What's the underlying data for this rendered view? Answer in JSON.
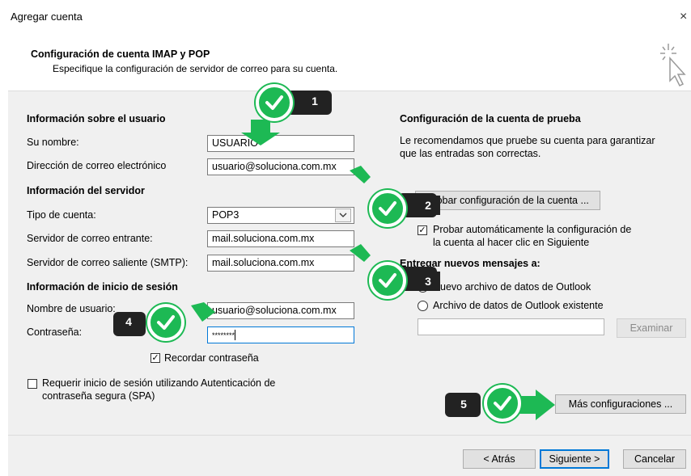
{
  "window": {
    "title": "Agregar cuenta",
    "close_glyph": "×"
  },
  "header": {
    "title": "Configuración de cuenta IMAP y POP",
    "subtitle": "Especifique la configuración de servidor de correo para su cuenta."
  },
  "user_info": {
    "section": "Información sobre el usuario",
    "name_label": "Su nombre:",
    "name_value": "USUARIO",
    "email_label": "Dirección de correo electrónico",
    "email_value": "usuario@soluciona.com.mx"
  },
  "server_info": {
    "section": "Información del servidor",
    "type_label": "Tipo de cuenta:",
    "type_value": "POP3",
    "incoming_label": "Servidor de correo entrante:",
    "incoming_value": "mail.soluciona.com.mx",
    "outgoing_label": "Servidor de correo saliente (SMTP):",
    "outgoing_value": "mail.soluciona.com.mx"
  },
  "login_info": {
    "section": "Información de inicio de sesión",
    "user_label": "Nombre de usuario:",
    "user_value": "usuario@soluciona.com.mx",
    "password_label": "Contraseña:",
    "password_value": "********",
    "remember_label": "Recordar contraseña",
    "remember_checked": true
  },
  "spa": {
    "label_line1": "Requerir inicio de sesión utilizando Autenticación de",
    "label_line2": "contraseña segura (SPA)",
    "checked": false
  },
  "test": {
    "section": "Configuración de la cuenta de prueba",
    "desc_line1": "Le recomendamos que pruebe su cuenta para garantizar",
    "desc_line2": "que las entradas son correctas.",
    "test_button": "Probar configuración de la cuenta ...",
    "auto_line1": "Probar automáticamente la configuración de",
    "auto_line2": "la cuenta al hacer clic en Siguiente",
    "auto_checked": true
  },
  "deliver": {
    "section": "Entregar nuevos mensajes a:",
    "new_file": "Nuevo archivo de datos de Outlook",
    "existing_file": "Archivo de datos de Outlook existente",
    "browse": "Examinar"
  },
  "more_settings": "Más configuraciones ...",
  "footer": {
    "back": "< Atrás",
    "next": "Siguiente >",
    "cancel": "Cancelar"
  },
  "annotations": {
    "badge_1": "1",
    "badge_2": "2",
    "badge_3": "3",
    "badge_4": "4",
    "badge_5": "5",
    "badge_color": "#1db954"
  }
}
